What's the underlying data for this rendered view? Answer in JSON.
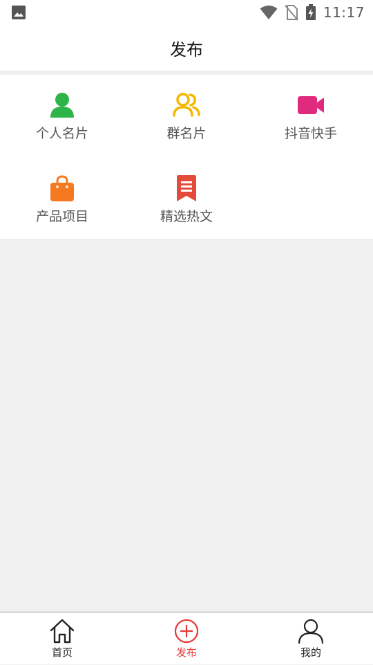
{
  "status_bar": {
    "time": "11:17",
    "icons": [
      "gallery-icon",
      "wifi-icon",
      "no-sim-icon",
      "battery-charging-icon"
    ]
  },
  "header": {
    "title": "发布"
  },
  "grid": {
    "items": [
      {
        "label": "个人名片",
        "icon": "person-icon",
        "color": "#2fb44a"
      },
      {
        "label": "群名片",
        "icon": "group-icon",
        "color": "#f5b800"
      },
      {
        "label": "抖音快手",
        "icon": "video-camera-icon",
        "color": "#e02a7d"
      },
      {
        "label": "产品项目",
        "icon": "shopping-bag-icon",
        "color": "#f5791f"
      },
      {
        "label": "精选热文",
        "icon": "article-bookmark-icon",
        "color": "#e44b3b"
      }
    ]
  },
  "bottom_nav": {
    "items": [
      {
        "label": "首页",
        "icon": "home-icon"
      },
      {
        "label": "发布",
        "icon": "add-circle-icon",
        "active": true
      },
      {
        "label": "我的",
        "icon": "user-icon"
      }
    ],
    "active_color": "#e53935"
  }
}
